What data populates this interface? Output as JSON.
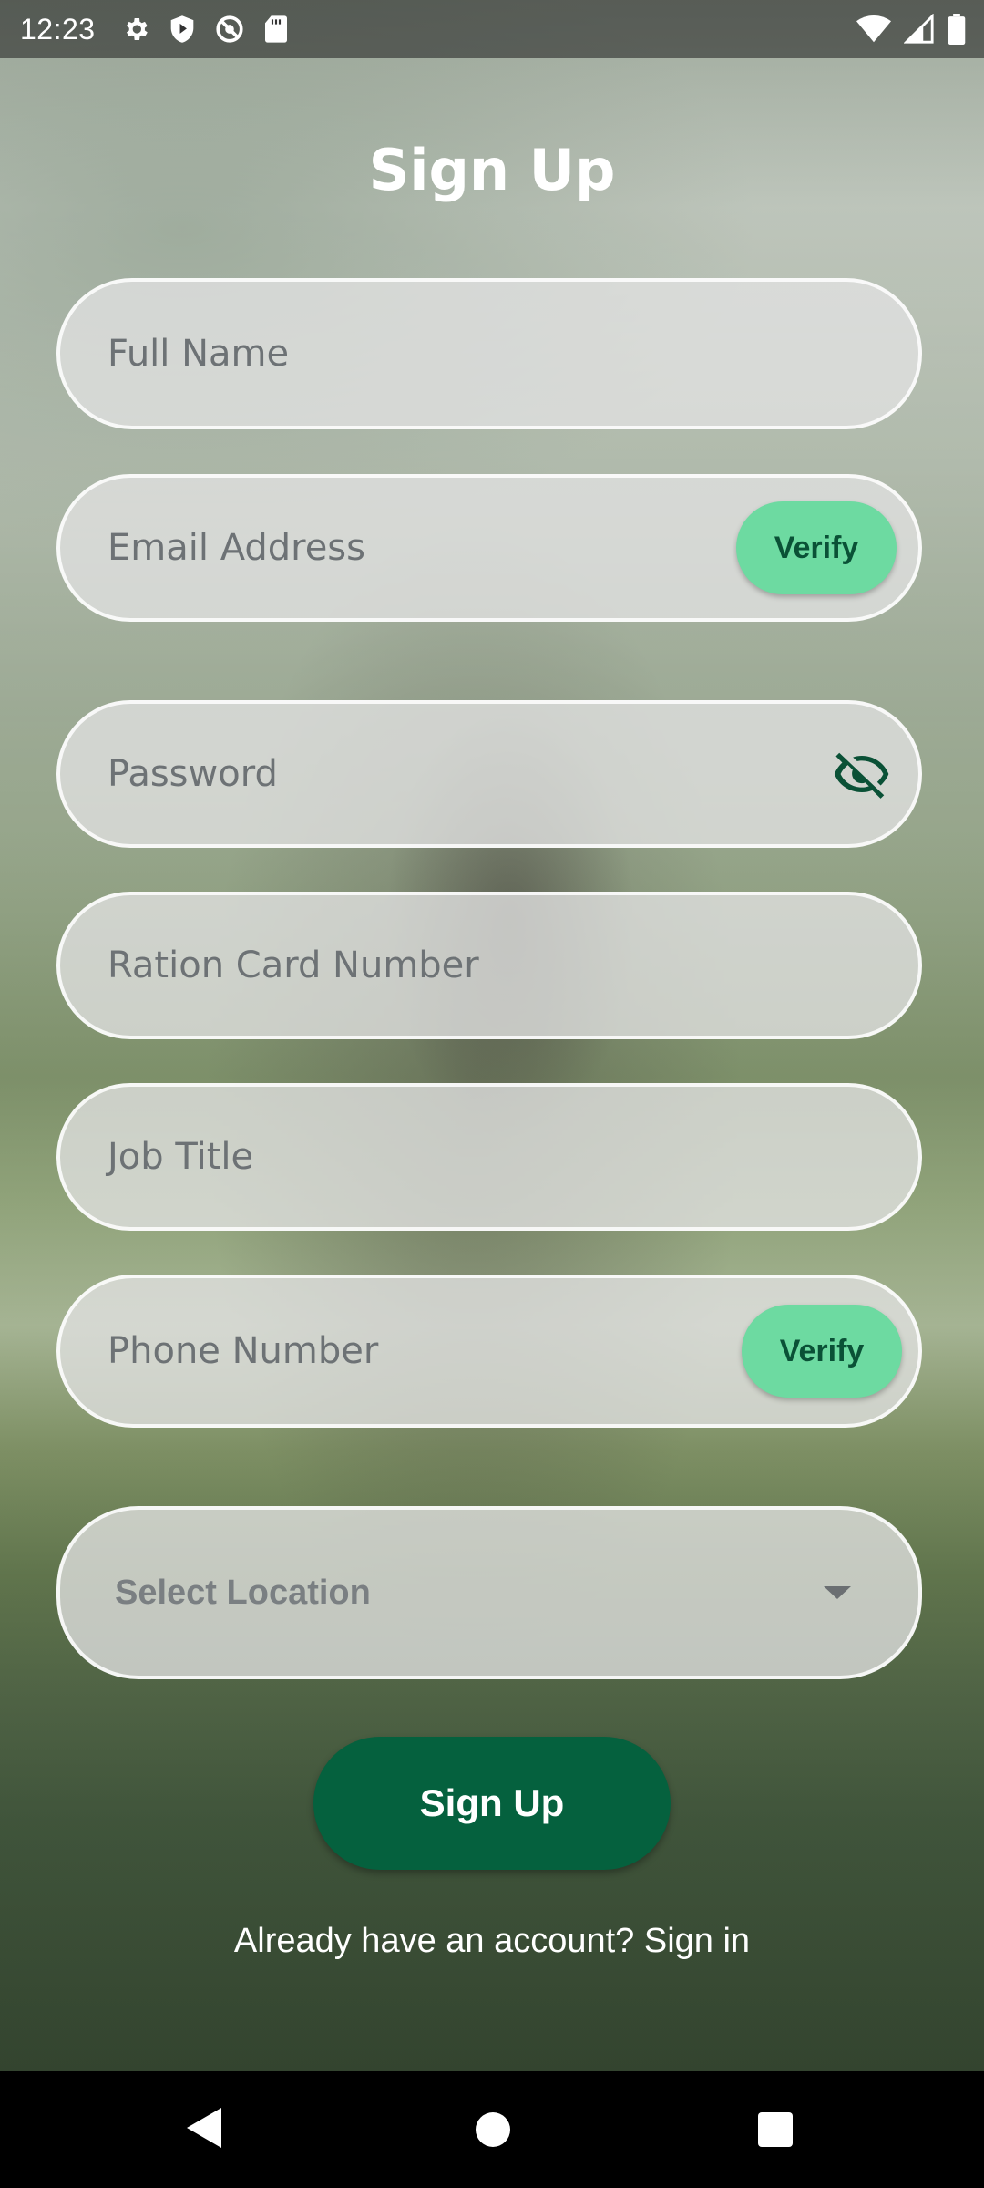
{
  "status_bar": {
    "time": "12:23",
    "left_icons": [
      "gear-icon",
      "shield-play-icon",
      "no-sync-icon",
      "sd-card-icon"
    ],
    "right_icons": [
      "wifi-icon",
      "signal-icon",
      "battery-icon"
    ]
  },
  "header": {
    "title": "Sign Up"
  },
  "form": {
    "full_name": {
      "placeholder": "Full Name"
    },
    "email": {
      "placeholder": "Email Address",
      "verify_label": "Verify"
    },
    "password": {
      "placeholder": "Password",
      "toggle_icon": "eye-off-icon"
    },
    "ration_card": {
      "placeholder": "Ration Card Number"
    },
    "job_title": {
      "placeholder": "Job Title"
    },
    "phone": {
      "placeholder": "Phone Number",
      "verify_label": "Verify"
    },
    "location": {
      "placeholder": "Select Location",
      "icon": "chevron-down-icon"
    }
  },
  "actions": {
    "signup_label": "Sign Up",
    "signin_prompt": "Already have an account? Sign in"
  },
  "colors": {
    "primary": "#05613e",
    "verify_bg": "#6ddaa1",
    "verify_text": "#0a5136",
    "eye_icon": "#0a5136"
  },
  "nav_bar": {
    "buttons": [
      "back-icon",
      "home-icon",
      "recents-icon"
    ]
  }
}
